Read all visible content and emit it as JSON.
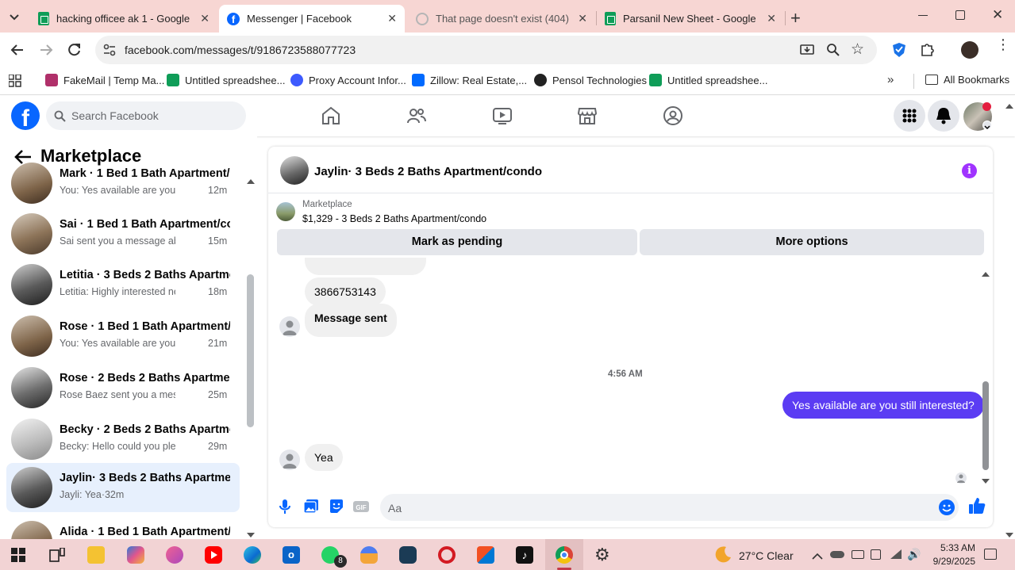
{
  "browser": {
    "tabs": [
      {
        "title": "hacking officee ak 1 - Google D",
        "icon": "sheets-icon"
      },
      {
        "title": "Messenger | Facebook",
        "icon": "facebook-icon",
        "active": true
      },
      {
        "title": "That page doesn't exist (404) - I",
        "icon": "globe-icon"
      },
      {
        "title": "Parsanil New Sheet - Google D",
        "icon": "sheets-icon"
      }
    ],
    "url": "facebook.com/messages/t/9186723588077723",
    "bookmarks": [
      {
        "label": "FakeMail | Temp Ma..."
      },
      {
        "label": "Untitled spreadshee..."
      },
      {
        "label": "Proxy Account Infor..."
      },
      {
        "label": "Zillow: Real Estate,..."
      },
      {
        "label": "Pensol Technologies"
      },
      {
        "label": "Untitled spreadshee..."
      }
    ],
    "all_bookmarks": "All Bookmarks"
  },
  "fb": {
    "search_placeholder": "Search Facebook"
  },
  "sidebar": {
    "title": "Marketplace",
    "conversations": [
      {
        "name": "Mark · 1 Bed 1 Bath Apartment/...",
        "preview": "You: Yes available are you still int...",
        "time": "12m"
      },
      {
        "name": "Sai · 1 Bed 1 Bath Apartment/co...",
        "preview": "Sai sent you a message about yo...",
        "time": "15m"
      },
      {
        "name": "Letitia · 3 Beds 2 Baths Apartme...",
        "preview": "Letitia: Highly interested need to ...",
        "time": "18m"
      },
      {
        "name": "Rose · 1 Bed 1 Bath Apartment/c...",
        "preview": "You: Yes available are you still int...",
        "time": "21m"
      },
      {
        "name": "Rose · 2 Beds 2 Baths Apartmen...",
        "preview": "Rose Baez sent you a message a...",
        "time": "25m"
      },
      {
        "name": "Becky · 2 Beds 2 Baths Apartme...",
        "preview": "Becky: Hello could you please pr...",
        "time": "29m"
      },
      {
        "name": "Jaylin· 3 Beds 2 Baths Apartmen...",
        "preview": "Jayli: Yea·32m",
        "time": ""
      },
      {
        "name": "Alida · 1 Bed 1 Bath Apartment/c...",
        "preview": "",
        "time": ""
      }
    ]
  },
  "chat": {
    "title": "Jaylin· 3 Beds 2 Baths Apartment/condo",
    "listing_label": "Marketplace",
    "listing_title": "$1,329 - 3 Beds 2 Baths Apartment/condo",
    "mark_pending": "Mark as pending",
    "more_options": "More options",
    "messages": [
      {
        "text": "3866753143",
        "from": "them"
      },
      {
        "text": "Message sent",
        "from": "them"
      },
      {
        "text": "Yes available are you still  interested?",
        "from": "me"
      },
      {
        "text": "Yea",
        "from": "them"
      }
    ],
    "timestamp": "4:56 AM",
    "input_placeholder": "Aa"
  },
  "taskbar": {
    "weather": "27°C  Clear",
    "time": "5:33 AM",
    "date": "9/29/2025",
    "whatsapp_badge": "8"
  },
  "colors": {
    "fb_blue": "#0866ff",
    "my_bubble": "#5b3cf3",
    "tabbar": "#f7d6d3",
    "info_purple": "#a033ff"
  }
}
